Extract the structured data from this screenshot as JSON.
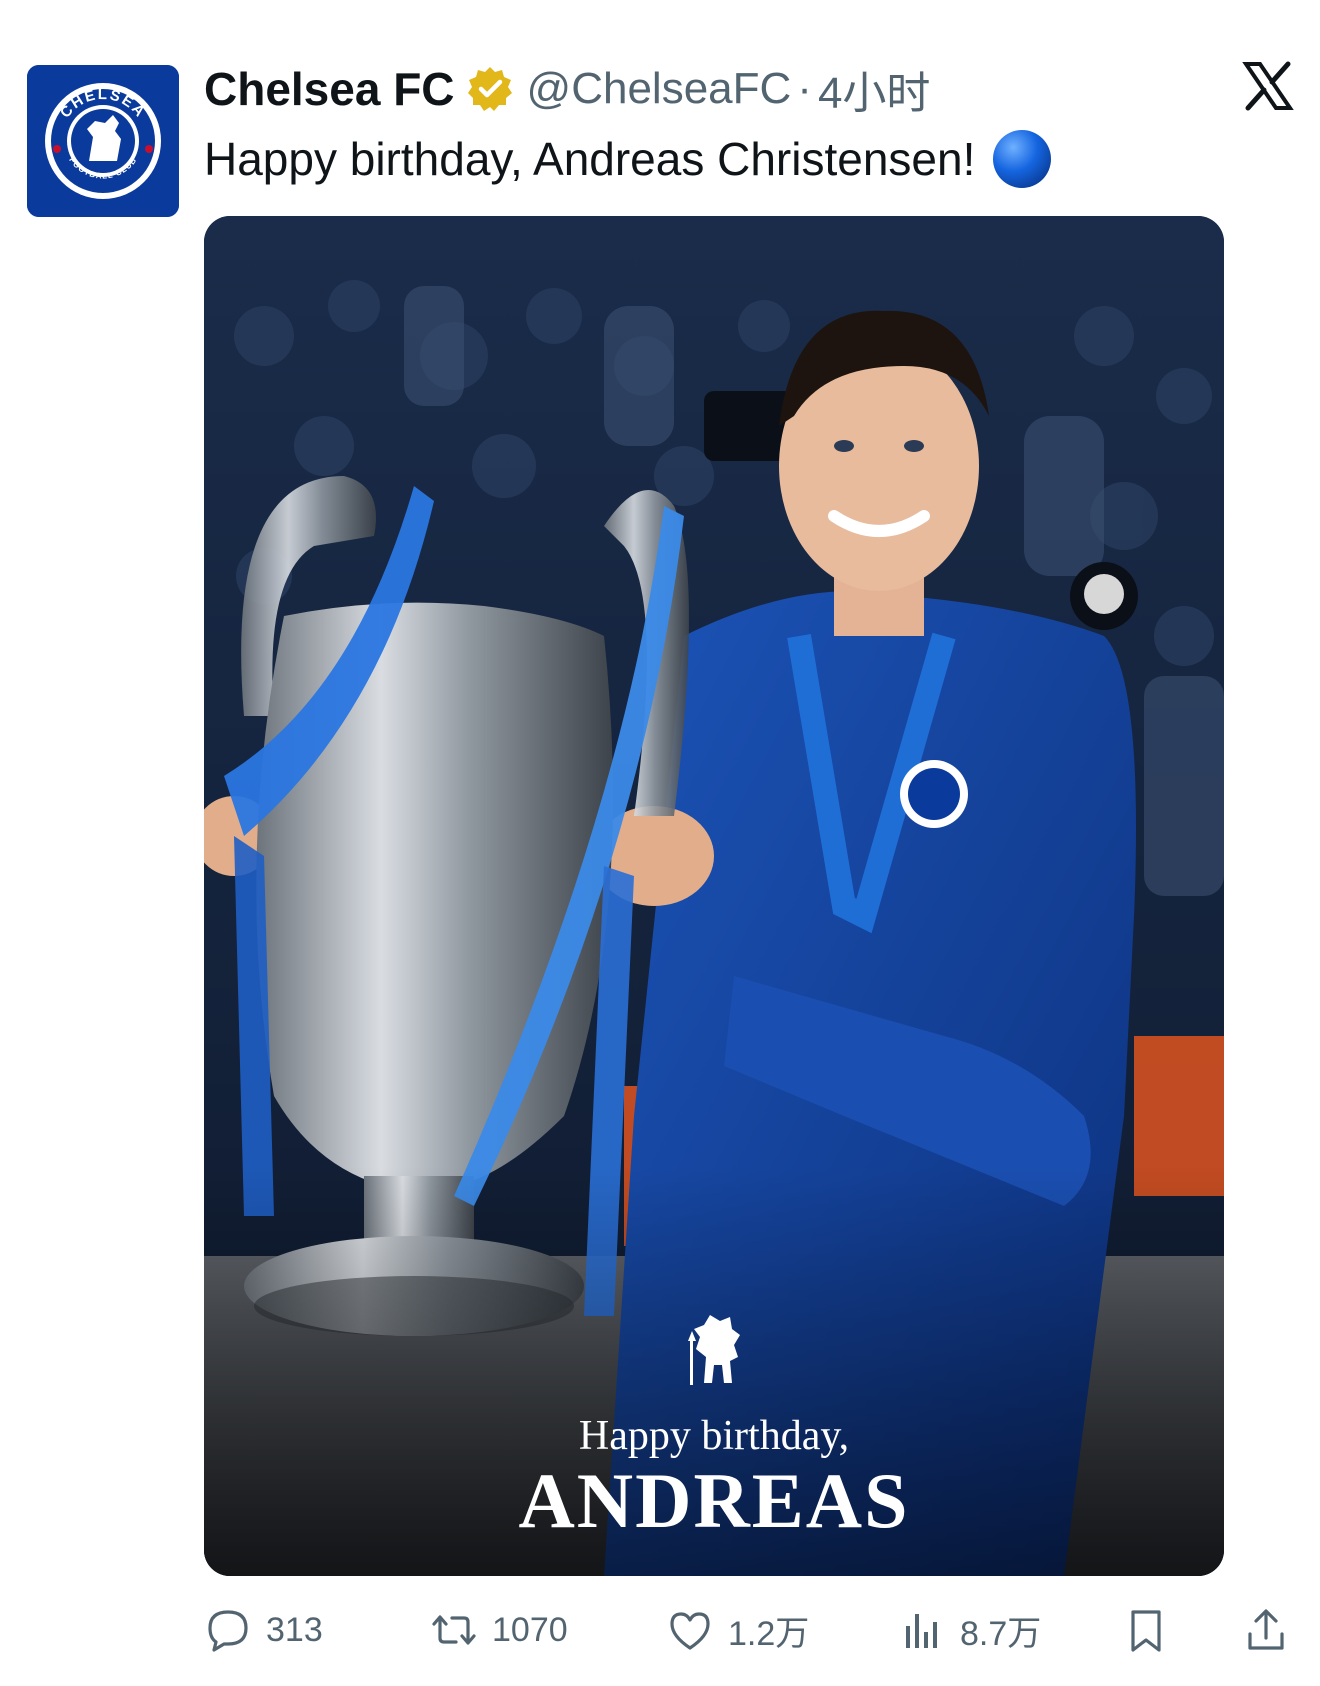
{
  "post": {
    "display_name": "Chelsea FC",
    "handle": "@ChelseaFC",
    "separator": "·",
    "time": "4小时",
    "text": "Happy birthday, Andreas Christensen!",
    "emoji": "blue-circle"
  },
  "avatar": {
    "crest_text_top": "CHELSEA",
    "crest_text_bottom": "FOOTBALL CLUB"
  },
  "media": {
    "overlay_subtitle": "Happy birthday,",
    "overlay_name": "ANDREAS",
    "icon": "chelsea-lion-icon"
  },
  "actions": {
    "replies": "313",
    "reposts": "1070",
    "likes": "1.2万",
    "views": "8.7万"
  },
  "colors": {
    "text_primary": "#0f1419",
    "text_secondary": "#536471",
    "verified_gold": "#e2b719",
    "chelsea_blue": "#0a3b9c"
  }
}
